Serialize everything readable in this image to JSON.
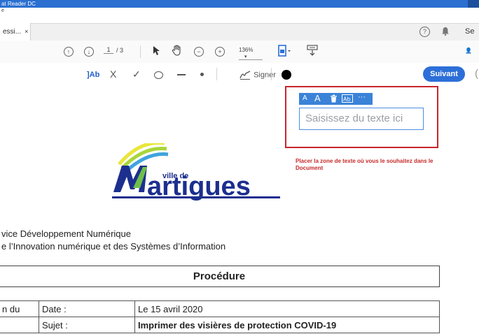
{
  "window": {
    "title": "at Reader DC",
    "menu_hint": "e"
  },
  "tab": {
    "label": "essi...",
    "close": "×"
  },
  "header_right": {
    "help": "?",
    "user_label": "Se"
  },
  "toolbar": {
    "page_current": "1",
    "page_total": "/ 3",
    "zoom": "136%",
    "zoom_caret": "▾"
  },
  "fill_sign": {
    "text_tool": "]Ab",
    "cross": "X",
    "check": "✓",
    "signer_label": "Signer",
    "next_button": "Suivant"
  },
  "textbox_toolbar": {
    "small_a": "A",
    "large_a": "A",
    "more": "···"
  },
  "textbox": {
    "placeholder": "Saisissez du texte ici"
  },
  "instruction": "Placer la zone de texte où vous le souhaitez dans le Document",
  "logo": {
    "small": "ville de",
    "big": "artigues"
  },
  "document": {
    "service_line1": "vice Développement Numérique",
    "service_line2": "e l’Innovation numérique et des Systèmes d’Information",
    "procedure_title": "Procédure",
    "rows": [
      {
        "c1": "n du",
        "c2": "Date :",
        "c3": "Le 15 avril 2020"
      },
      {
        "c1": "",
        "c2": "Sujet :",
        "c3": "Imprimer des visières de protection COVID-19"
      }
    ]
  },
  "colors": {
    "accent": "#2d6fd8",
    "frame_red": "#c8242b",
    "titlebar": "#2b6fd1"
  }
}
